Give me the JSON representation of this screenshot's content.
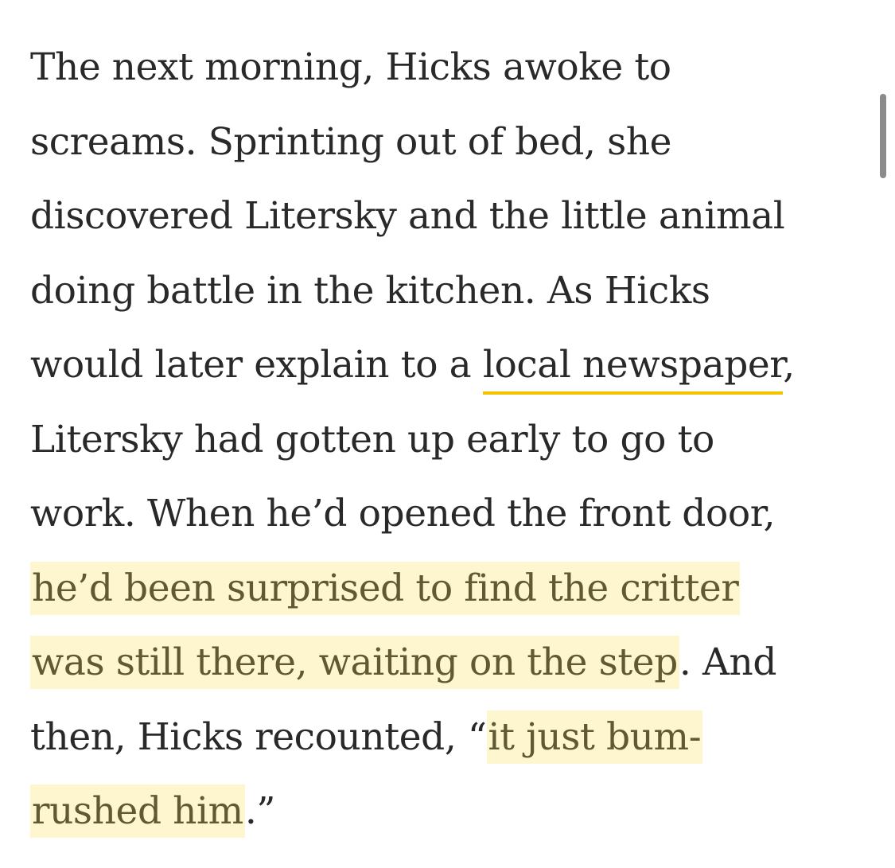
{
  "paragraph": {
    "line1": "The next morning, Hicks awoke to",
    "line2": "screams. Sprinting out of bed, she",
    "line3": "discovered Litersky and the little animal",
    "line4": "doing battle in the kitchen. As Hicks",
    "line5_pre": "would later explain to a ",
    "line5_link": "local newspaper",
    "line5_post": ",",
    "line6": "Litersky had gotten up early to go to",
    "line7": "work. When he’d opened the front door,",
    "line8_hl": "he’d been surprised to find the critter",
    "line9_hl": "was still there, waiting on the step",
    "line9_post": ". And",
    "line10_pre": "then, Hicks recounted, “",
    "line10_hl": "it just bum-",
    "line11_hl": "rushed him",
    "line11_post": ".”"
  },
  "colors": {
    "text": "#292929",
    "link_underline": "#f2c300",
    "highlight_bg": "#fdf6cf",
    "highlight_text": "#605a33",
    "scrollbar": "#8b8b8b"
  }
}
